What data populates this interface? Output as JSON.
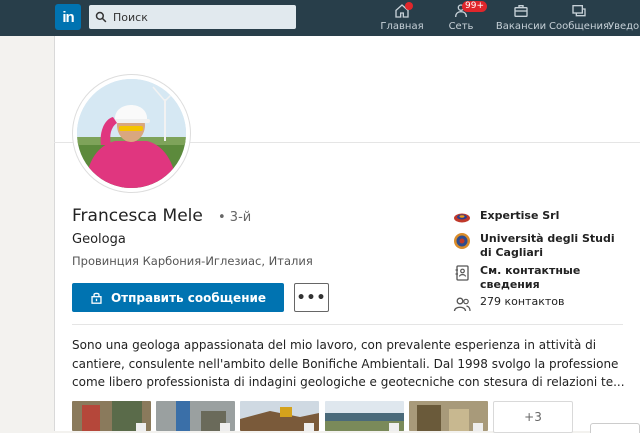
{
  "topbar": {
    "logo_text": "in",
    "search_placeholder": "Поиск",
    "nav": [
      {
        "label": "Главная",
        "icon": "home-icon"
      },
      {
        "label": "Сеть",
        "icon": "network-icon",
        "badge": "99+"
      },
      {
        "label": "Вакансии",
        "icon": "jobs-icon"
      },
      {
        "label": "Сообщения",
        "icon": "messaging-icon"
      },
      {
        "label": "Уведом",
        "icon": "notifications-icon"
      }
    ]
  },
  "profile": {
    "name": "Francesca Mele",
    "degree": "• 3-й",
    "headline": "Geologa",
    "location": "Провинция Карбония-Иглезиас, Италия",
    "message_button": "Отправить сообщение",
    "more_button": "•••"
  },
  "sidebar": {
    "company": "Expertise Srl",
    "school": "Università degli Studi di Cagliari",
    "contact_info": "См. контактные сведения",
    "connections": "279 контактов"
  },
  "summary": "Sono una geologa appassionata del mio lavoro, con prevalente esperienza in attività di cantiere, consulente nell'ambito delle Bonifiche Ambientali. Dal 1998 svolgo la professione come libero professionista di indagini geologiche e geotecniche con stesura di relazioni te...",
  "media_more": "+3",
  "colors": {
    "topbar": "#283e4a",
    "brand": "#0073b1",
    "badge": "#e0262b"
  }
}
